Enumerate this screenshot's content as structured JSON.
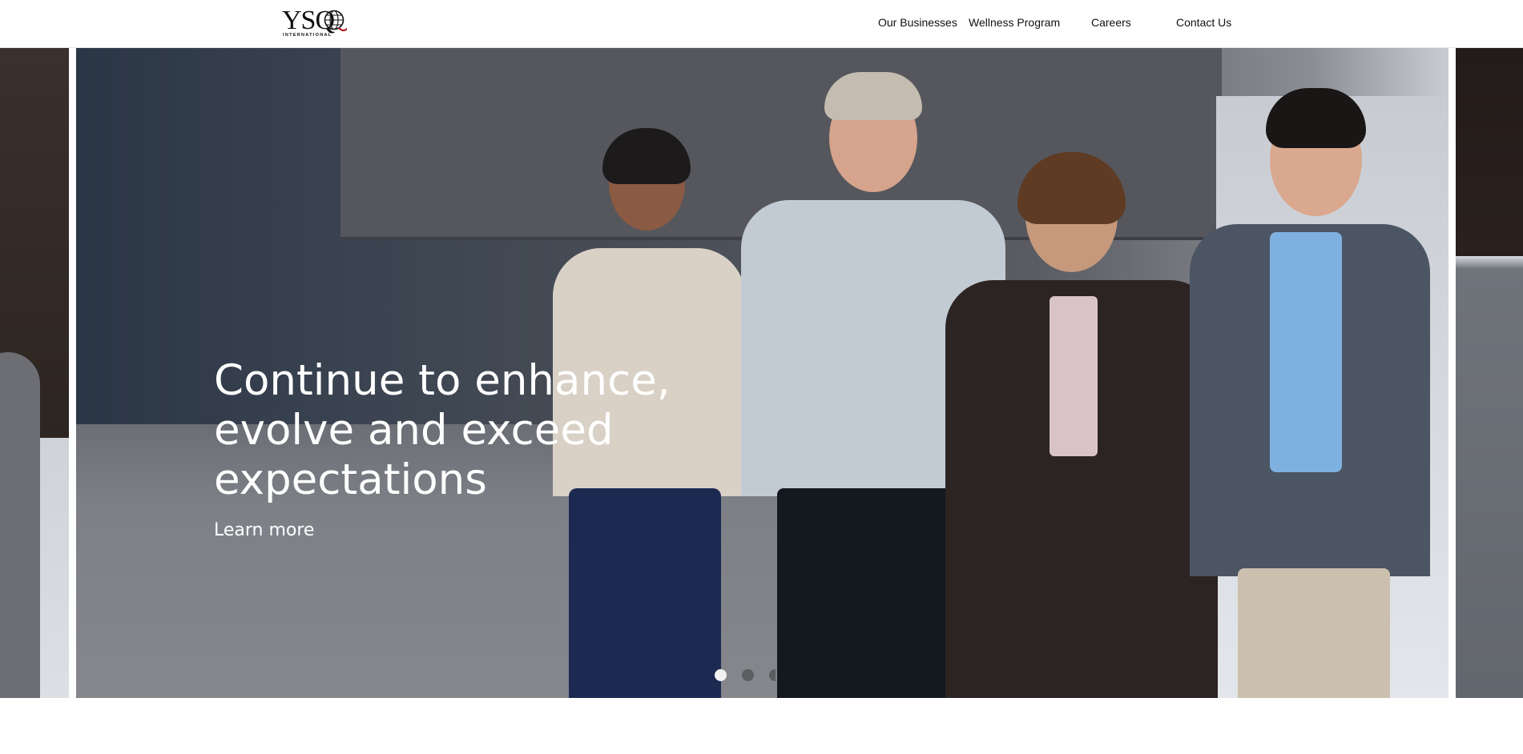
{
  "header": {
    "logo_text": "YSQ",
    "logo_subtext": "INTERNATIONAL",
    "nav": [
      {
        "label": "Our Businesses"
      },
      {
        "label": "Wellness Program"
      },
      {
        "label": "Careers"
      },
      {
        "label": "Contact Us"
      }
    ]
  },
  "hero": {
    "title": "Continue to enhance,\nevolve and exceed\nexpectations",
    "link_label": "Learn more",
    "slide_count": 3,
    "active_slide": 1
  },
  "colors": {
    "logo_accent": "#b3131b",
    "text_on_hero": "#ffffff"
  }
}
